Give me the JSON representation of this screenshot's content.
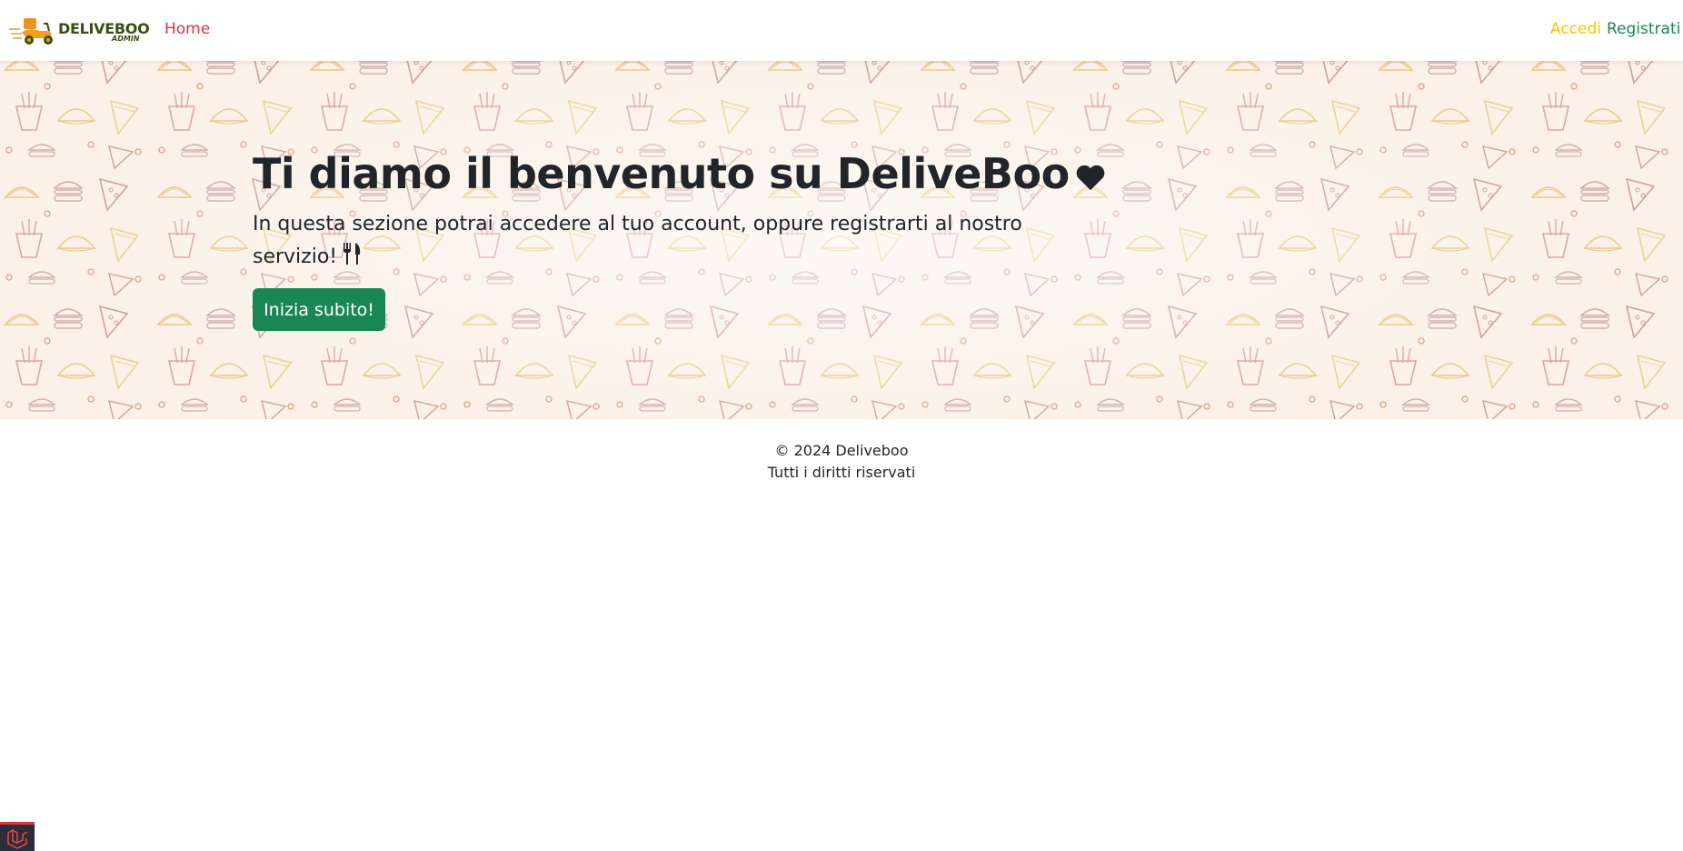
{
  "navbar": {
    "brand_name": "DELIVEBOO",
    "brand_sub": "ADMIN",
    "home_label": "Home",
    "login_label": "Accedi",
    "register_label": "Registrati"
  },
  "hero": {
    "title": "Ti diamo il benvenuto su DeliveBoo",
    "title_icon": "heart-icon",
    "subtitle": "In questa sezione potrai accedere al tuo account, oppure registrarti al nostro servizio!",
    "subtitle_icon": "cutlery-icon",
    "cta_label": "Inizia subito!"
  },
  "footer": {
    "copyright": "© 2024 Deliveboo",
    "rights": "Tutti i diritti riservati"
  },
  "debug_badge": {
    "icon": "laravel-icon"
  },
  "colors": {
    "home_link": "#dc3545",
    "login_link": "#ffc107",
    "register_link": "#198754",
    "cta": "#198754",
    "hero_bg": "#fbf1e8",
    "brand": "#3b4d12"
  }
}
